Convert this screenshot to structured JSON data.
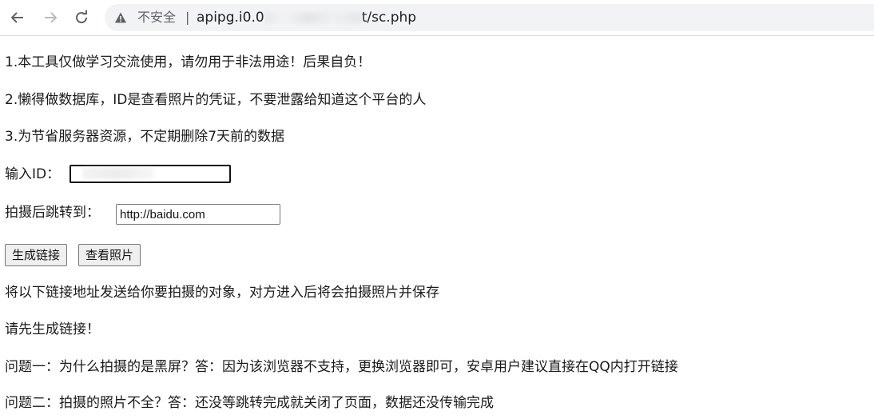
{
  "browser": {
    "insecure_label": "不安全",
    "separator": "|",
    "url_prefix": "apipg.i0.0",
    "url_suffix": "t/sc.php",
    "icons": {
      "back": "arrow-left-icon",
      "forward": "arrow-right-icon",
      "reload": "reload-icon",
      "warning": "warning-triangle-icon"
    }
  },
  "notes": [
    "1.本工具仅做学习交流使用，请勿用于非法用途！后果自负！",
    "2.懒得做数据库，ID是查看照片的凭证，不要泄露给知道这个平台的人",
    "3.为节省服务器资源，不定期删除7天前的数据"
  ],
  "form": {
    "id_label": "输入ID：",
    "id_value": "",
    "redirect_label": "拍摄后跳转到：",
    "redirect_value": "http://baidu.com",
    "generate_button": "生成链接",
    "view_button": "查看照片"
  },
  "info": {
    "send_hint": "将以下链接地址发送给你要拍摄的对象，对方进入后将会拍摄照片并保存",
    "link_status": "请先生成链接！",
    "faq1": "问题一：为什么拍摄的是黑屏？答：因为该浏览器不支持，更换浏览器即可，安卓用户建议直接在QQ内打开链接",
    "faq2": "问题二：拍摄的照片不全？答：还没等跳转完成就关闭了页面，数据还没传输完成"
  },
  "colors": {
    "toolbar_icon": "#5f6368",
    "forward_disabled": "#b8bbbf",
    "omnibox_bg": "#f1f3f4"
  }
}
